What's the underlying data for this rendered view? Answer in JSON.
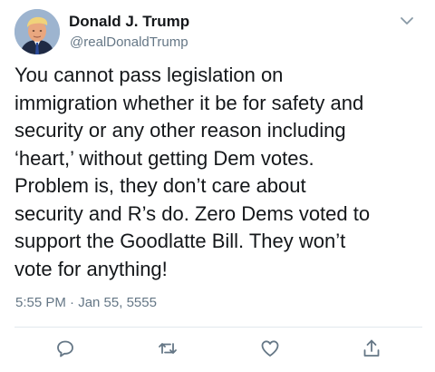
{
  "tweet": {
    "display_name": "Donald J. Trump",
    "handle": "@realDonaldTrump",
    "text": "You cannot pass legislation on\nimmigration whether it be for safety and\nsecurity or any other reason including\n‘heart,’ without getting Dem votes.\nProblem is, they don’t care about\nsecurity and R’s do. Zero Dems voted to\nsupport the Goodlatte Bill. They won’t\nvote for anything!",
    "timestamp": "5:55 PM · Jan 55, 5555"
  },
  "icons": {
    "menu": "chevron-down-icon",
    "reply": "reply-icon",
    "retweet": "retweet-icon",
    "like": "heart-icon",
    "share": "share-icon"
  },
  "colors": {
    "text": "#14171a",
    "secondary": "#657786",
    "divider": "#e1e8ed"
  }
}
